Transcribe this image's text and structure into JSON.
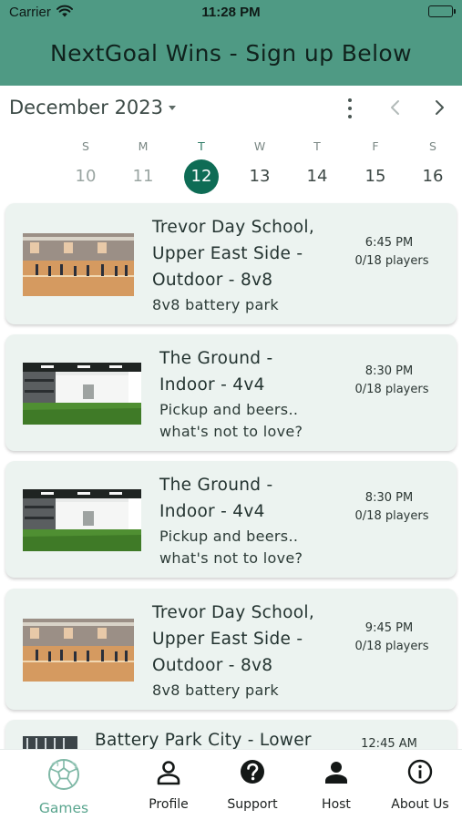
{
  "status_bar": {
    "carrier": "Carrier",
    "time": "11:28 PM"
  },
  "app": {
    "title": "NextGoal Wins - Sign up Below",
    "accent": "#4f9a84",
    "selected_color": "#0e6c55"
  },
  "calendar": {
    "month_label": "December 2023",
    "weekdays": [
      "S",
      "M",
      "T",
      "W",
      "T",
      "F",
      "S"
    ],
    "dates": [
      "10",
      "11",
      "12",
      "13",
      "14",
      "15",
      "16"
    ],
    "selected_date": "12",
    "icons": [
      "more-vert-icon",
      "chevron-left-icon",
      "chevron-right-icon"
    ]
  },
  "games": [
    {
      "title_lines": [
        "Trevor Day School,",
        "Upper East Side -",
        "Outdoor - 8v8"
      ],
      "desc_lines": [
        "8v8 battery park"
      ],
      "time": "6:45 PM",
      "players": "0/18 players",
      "thumbnail": "gym-court-photo"
    },
    {
      "title_lines": [
        "The Ground -",
        "Indoor - 4v4"
      ],
      "desc_lines": [
        "Pickup and beers..",
        "what's not to love?"
      ],
      "time": "8:30 PM",
      "players": "0/18 players",
      "thumbnail": "indoor-turf-photo"
    },
    {
      "title_lines": [
        "The Ground -",
        "Indoor - 4v4"
      ],
      "desc_lines": [
        "Pickup and beers..",
        "what's not to love?"
      ],
      "time": "8:30 PM",
      "players": "0/18 players",
      "thumbnail": "indoor-turf-photo"
    },
    {
      "title_lines": [
        "Trevor Day School,",
        "Upper East Side -",
        "Outdoor - 8v8"
      ],
      "desc_lines": [
        "8v8 battery park"
      ],
      "time": "9:45 PM",
      "players": "0/18 players",
      "thumbnail": "gym-court-photo"
    },
    {
      "title_lines": [
        "Battery Park City - Lower"
      ],
      "desc_lines": [],
      "time": "12:45 AM",
      "players": "",
      "thumbnail": "outdoor-field-photo"
    }
  ],
  "nav": {
    "items": [
      {
        "label": "Games",
        "icon": "soccer-ball-icon",
        "active": true
      },
      {
        "label": "Profile",
        "icon": "person-outline-icon"
      },
      {
        "label": "Support",
        "icon": "help-circle-icon"
      },
      {
        "label": "Host",
        "icon": "person-icon"
      },
      {
        "label": "About Us",
        "icon": "info-icon"
      }
    ]
  }
}
